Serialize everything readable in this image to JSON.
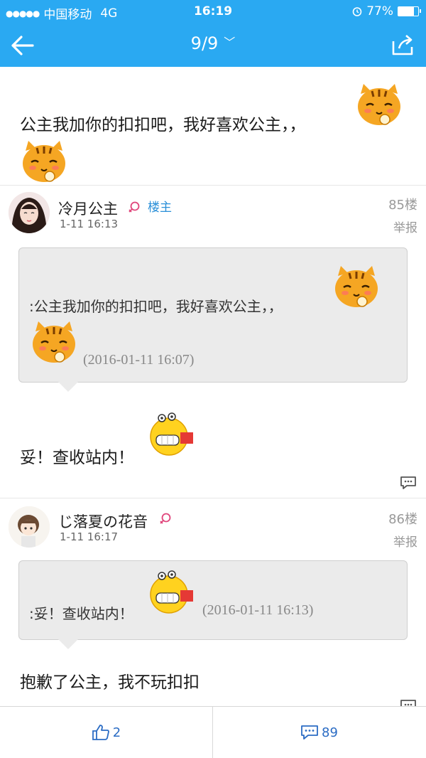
{
  "status_bar": {
    "carrier": "中国移动",
    "network": "4G",
    "time": "16:19",
    "battery_pct": "77%",
    "battery_level": 0.77
  },
  "nav": {
    "title": "9/9"
  },
  "top_post": {
    "text": "公主我加你的扣扣吧，我好喜欢公主，，"
  },
  "posts": [
    {
      "user": "冷月公主",
      "badge": "楼主",
      "time": "1-11 16:13",
      "floor": "85楼",
      "report": "举报",
      "quote_text": ":公主我加你的扣扣吧，我好喜欢公主，，",
      "quote_date": "(2016-01-11 16:07)",
      "reply_text": "妥！查收站内！"
    },
    {
      "user": "じ落夏の花音",
      "time": "1-11 16:17",
      "floor": "86楼",
      "report": "举报",
      "quote_text": ":妥！查收站内！",
      "quote_date": "(2016-01-11 16:13)",
      "reply_text": "抱歉了公主，我不玩扣扣"
    }
  ],
  "bottom_bar": {
    "like_count": "2",
    "comment_count": "89"
  },
  "colors": {
    "accent": "#2aa9f2",
    "link": "#2b6cc4"
  }
}
